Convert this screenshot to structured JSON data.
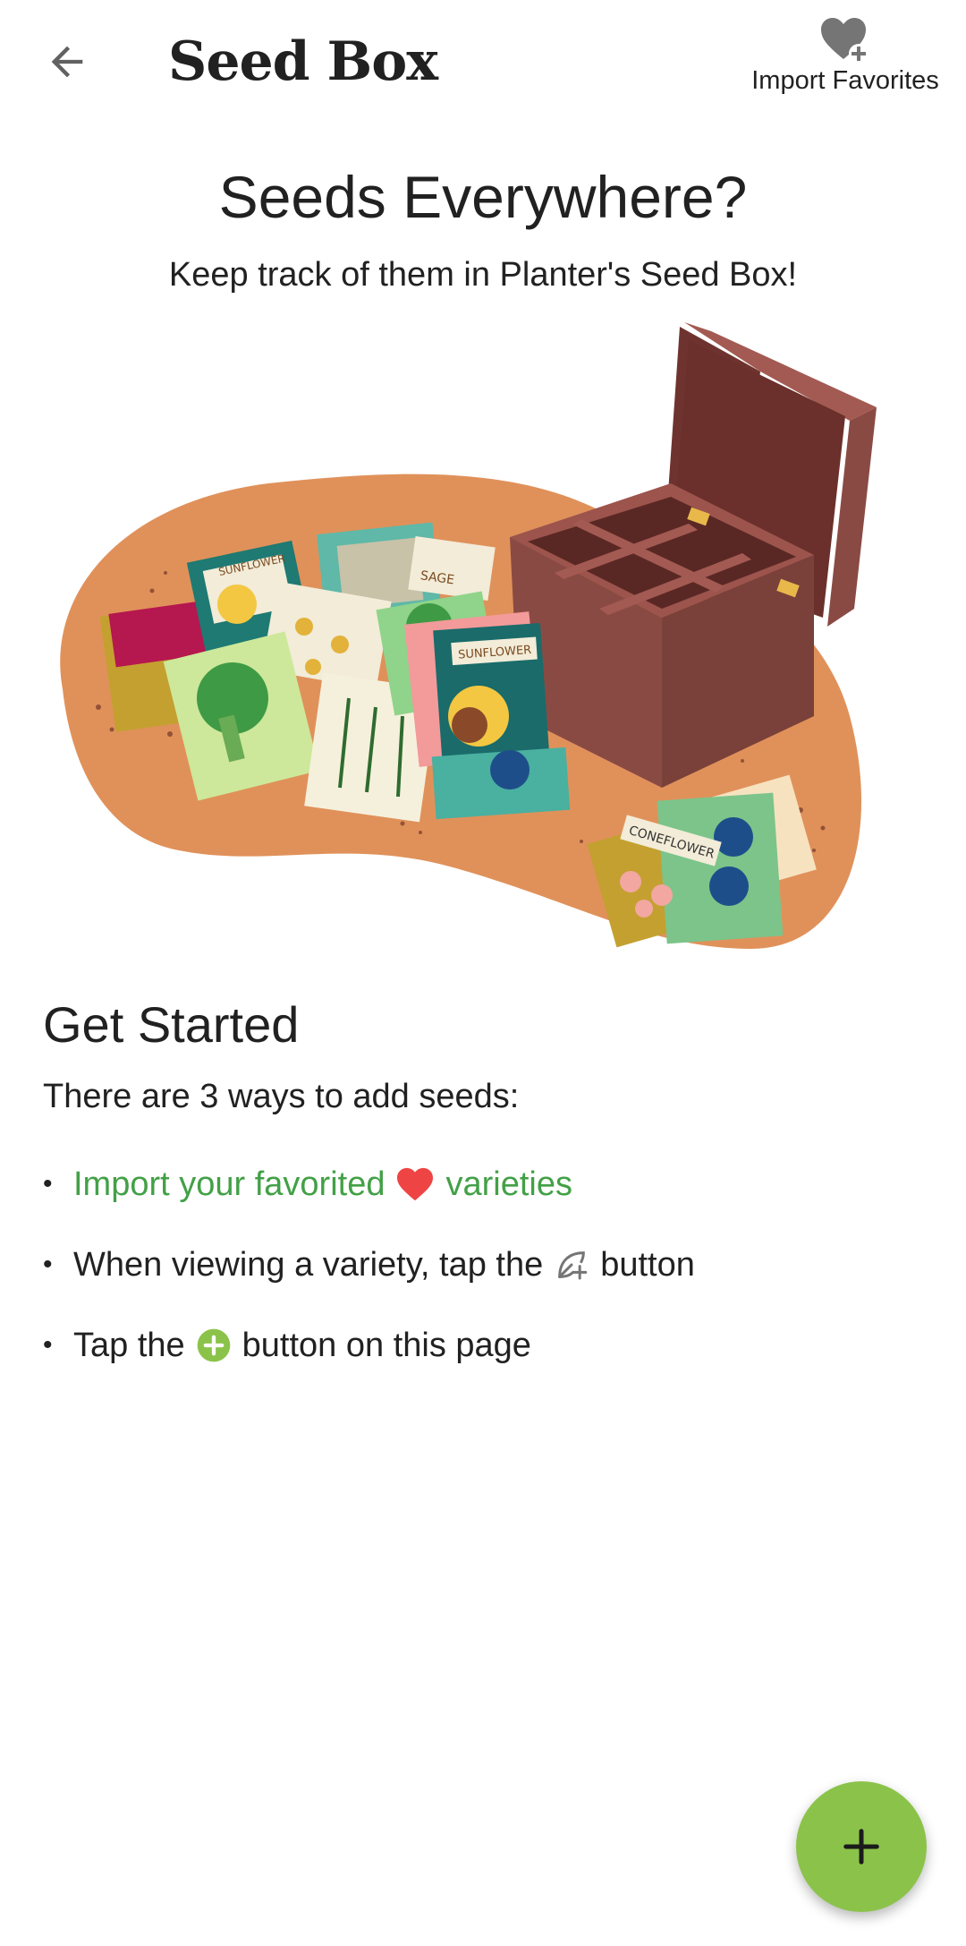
{
  "app_bar": {
    "title": "Seed Box",
    "back_icon": "arrow-back-icon",
    "import_favorites_label": "Import Favorites",
    "import_favorites_icon": "heart-plus-icon"
  },
  "hero": {
    "title": "Seeds Everywhere?",
    "subtitle": "Keep track of them in Planter's Seed Box!",
    "illustration": {
      "description_icon": "seed-packets-and-box-illustration",
      "packet_labels": [
        "SUNFLOWER",
        "SAGE",
        "SUNFLOWER",
        "CONEFLOWER"
      ]
    }
  },
  "get_started": {
    "heading": "Get Started",
    "intro": "There are 3 ways to add seeds:",
    "ways": [
      {
        "before": "Import your favorited",
        "icon": "heart-icon",
        "after": "varieties",
        "link": true
      },
      {
        "before": "When viewing a variety, tap the",
        "icon": "leaf-plus-icon",
        "after": "button",
        "link": false
      },
      {
        "before": "Tap the",
        "icon": "green-plus-circle-icon",
        "after": "button on this page",
        "link": false
      }
    ]
  },
  "fab": {
    "icon": "plus-icon"
  },
  "colors": {
    "accent_green": "#8bc34a",
    "link_green": "#43a047",
    "heart_red": "#ef4444",
    "blob_orange": "#e0915a",
    "box_brown": "#8a4a44"
  }
}
